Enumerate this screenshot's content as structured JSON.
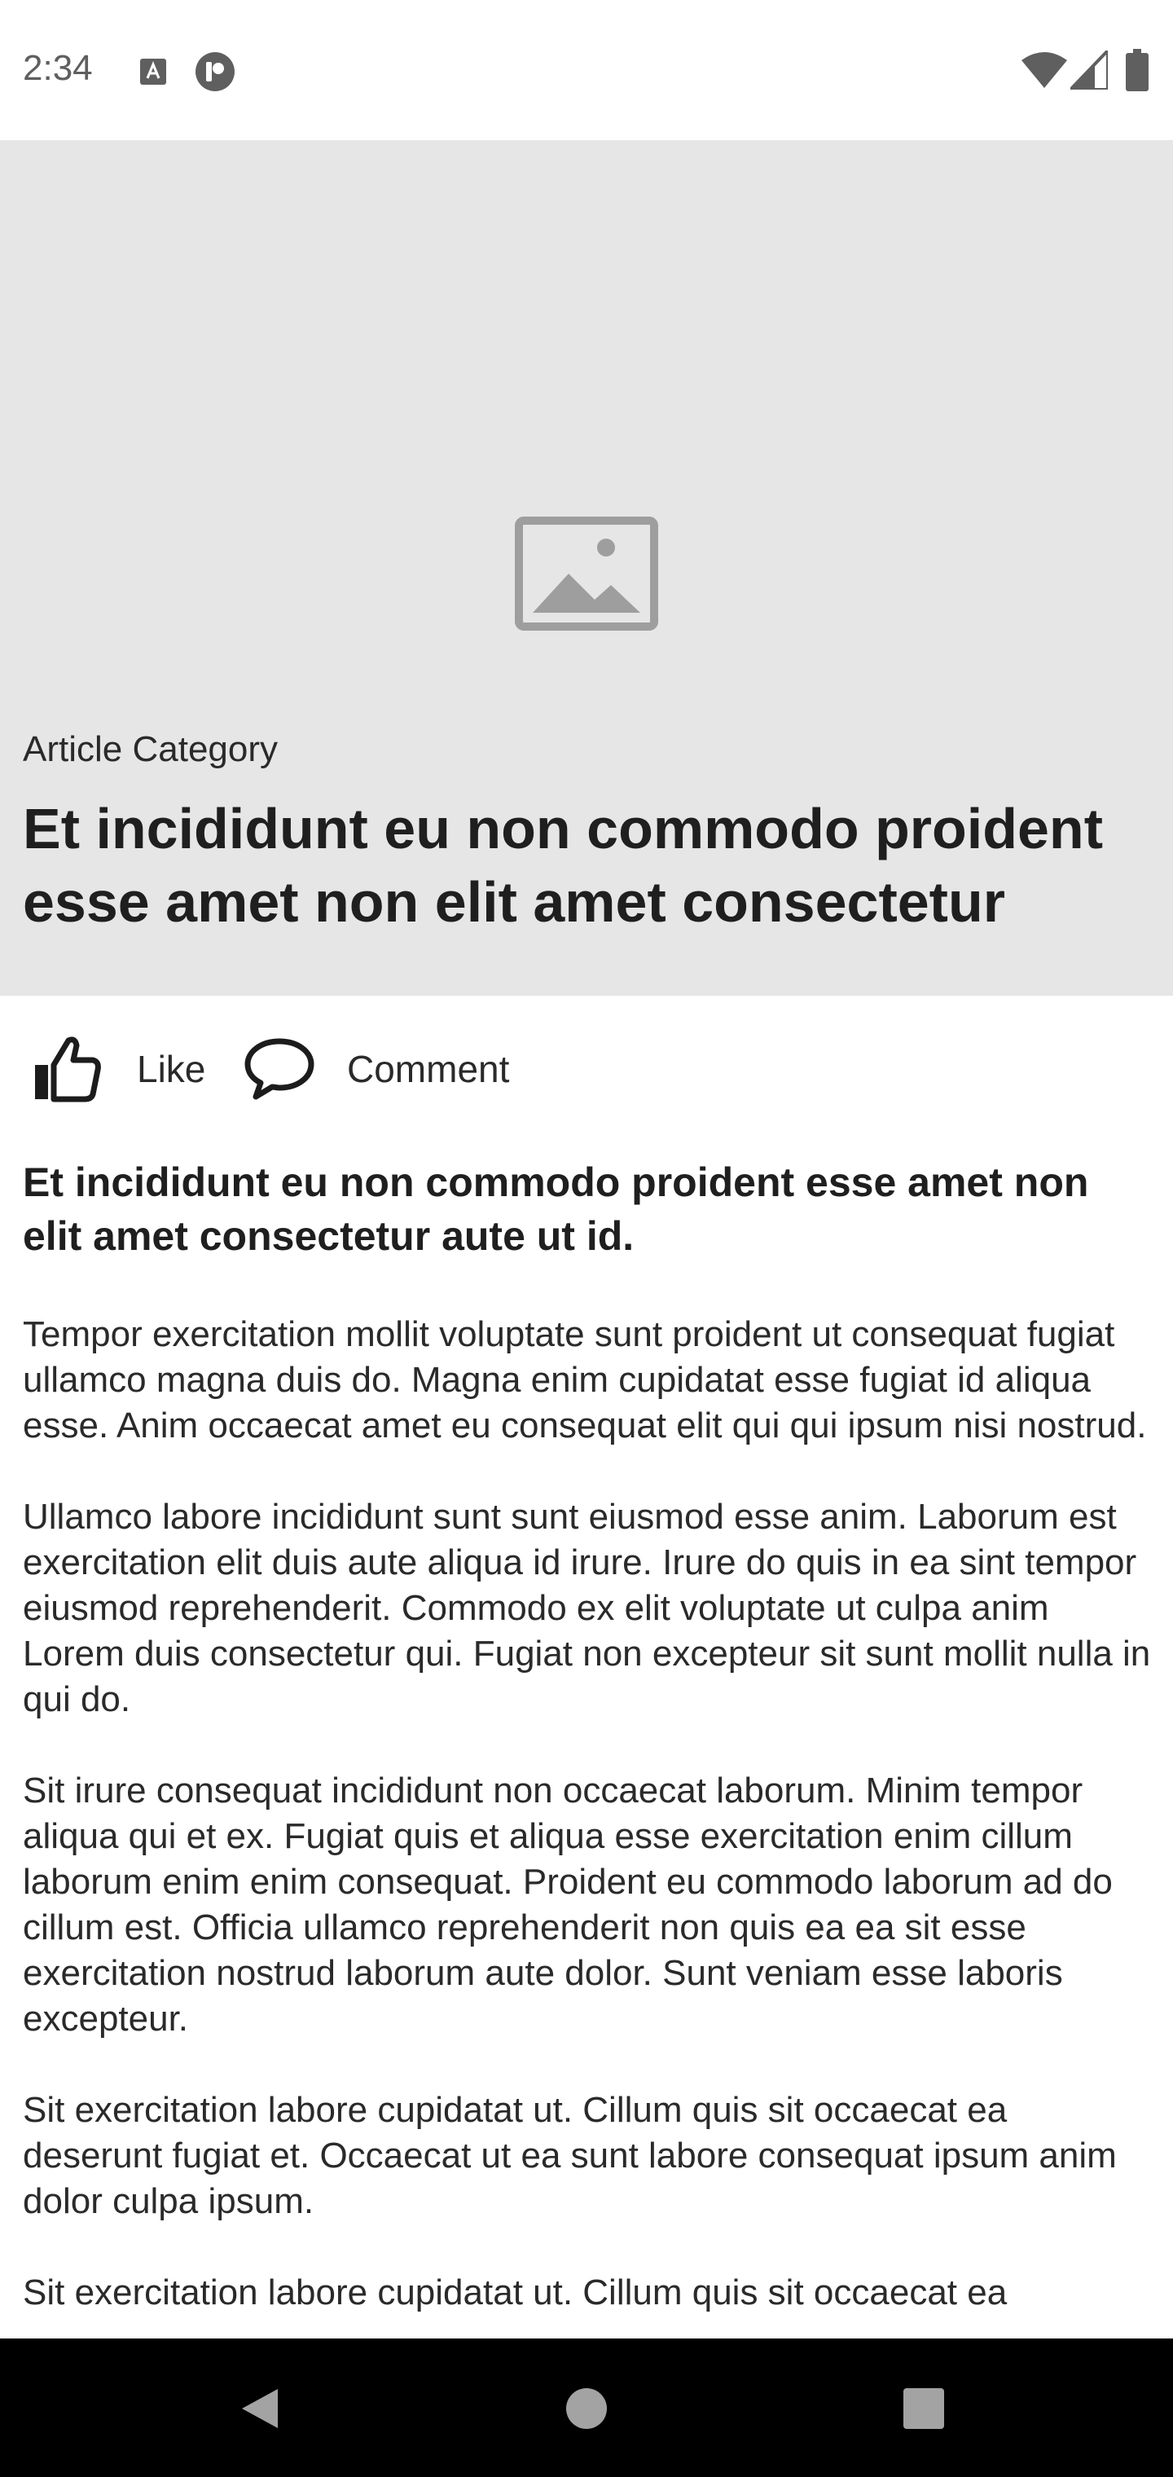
{
  "status_bar": {
    "time": "2:34",
    "icons": [
      "text-recognition-icon",
      "app-notification-icon",
      "wifi-icon",
      "signal-icon",
      "battery-icon"
    ]
  },
  "hero": {
    "image_icon": "image-placeholder-icon",
    "category": "Article Category",
    "title": "Et incididunt eu non commodo proident esse amet non elit amet consectetur"
  },
  "actions": {
    "like_label": "Like",
    "like_icon": "thumbs-up-icon",
    "comment_label": "Comment",
    "comment_icon": "comment-bubble-icon"
  },
  "content": {
    "lead": "Et incididunt eu non commodo proident esse amet non elit amet consectetur aute ut id.",
    "paragraphs": [
      "Tempor exercitation mollit voluptate sunt proident ut consequat fugiat ullamco magna duis do. Magna enim cupidatat esse fugiat id aliqua esse. Anim occaecat amet eu consequat elit qui qui ipsum nisi nostrud.",
      "Ullamco labore incididunt sunt sunt eiusmod esse anim. Laborum est exercitation elit duis aute aliqua id irure. Irure do quis in ea sint tempor eiusmod reprehenderit. Commodo ex elit voluptate ut culpa anim Lorem duis consectetur qui. Fugiat non excepteur sit sunt mollit nulla in qui do.",
      "Sit irure consequat incididunt non occaecat laborum. Minim tempor aliqua qui et ex. Fugiat quis et aliqua esse exercitation enim cillum laborum enim enim consequat. Proident eu commodo laborum ad do cillum est. Officia ullamco reprehenderit non quis ea ea sit esse exercitation nostrud laborum aute dolor. Sunt veniam esse laboris excepteur.",
      "Sit exercitation labore cupidatat ut. Cillum quis sit occaecat ea deserunt fugiat et. Occaecat ut ea sunt labore consequat ipsum anim dolor culpa ipsum.",
      "Sit exercitation labore cupidatat ut. Cillum quis sit occaecat ea"
    ]
  },
  "nav_bar": {
    "back_icon": "back-triangle-icon",
    "home_icon": "home-circle-icon",
    "recents_icon": "recents-square-icon"
  }
}
